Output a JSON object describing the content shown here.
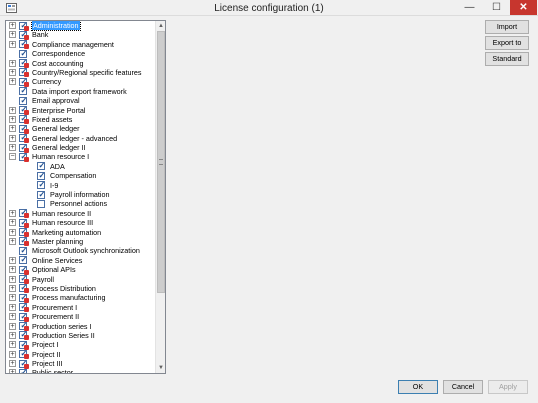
{
  "window": {
    "title": "License configuration (1)",
    "close_label": "✕",
    "min_label": "—",
    "max_label": "☐"
  },
  "tree": {
    "rows": [
      {
        "label": "Administration",
        "level": 0,
        "expander": "+",
        "mark": true,
        "selected": true
      },
      {
        "label": "Bank",
        "level": 0,
        "expander": "+",
        "mark": true
      },
      {
        "label": "Compliance management",
        "level": 0,
        "expander": "+",
        "mark": true
      },
      {
        "label": "Correspondence",
        "level": 0,
        "expander": "",
        "mark": false
      },
      {
        "label": "Cost accounting",
        "level": 0,
        "expander": "+",
        "mark": true
      },
      {
        "label": "Country/Regional specific features",
        "level": 0,
        "expander": "+",
        "mark": true
      },
      {
        "label": "Currency",
        "level": 0,
        "expander": "+",
        "mark": true
      },
      {
        "label": "Data import export framework",
        "level": 0,
        "expander": "",
        "mark": false
      },
      {
        "label": "Email approval",
        "level": 0,
        "expander": "",
        "mark": false
      },
      {
        "label": "Enterprise Portal",
        "level": 0,
        "expander": "+",
        "mark": true
      },
      {
        "label": "Fixed assets",
        "level": 0,
        "expander": "+",
        "mark": true
      },
      {
        "label": "General ledger",
        "level": 0,
        "expander": "+",
        "mark": true
      },
      {
        "label": "General ledger - advanced",
        "level": 0,
        "expander": "+",
        "mark": true
      },
      {
        "label": "General ledger II",
        "level": 0,
        "expander": "+",
        "mark": true
      },
      {
        "label": "Human resource I",
        "level": 0,
        "expander": "−",
        "mark": true
      },
      {
        "label": "ADA",
        "level": 1,
        "expander": "",
        "mark": false
      },
      {
        "label": "Compensation",
        "level": 1,
        "expander": "",
        "mark": false
      },
      {
        "label": "I-9",
        "level": 1,
        "expander": "",
        "mark": false
      },
      {
        "label": "Payroll information",
        "level": 1,
        "expander": "",
        "mark": false
      },
      {
        "label": "Personnel actions",
        "level": 1,
        "expander": "",
        "mark": false,
        "unchecked": true
      },
      {
        "label": "Human resource II",
        "level": 0,
        "expander": "+",
        "mark": true
      },
      {
        "label": "Human resource III",
        "level": 0,
        "expander": "+",
        "mark": true
      },
      {
        "label": "Marketing automation",
        "level": 0,
        "expander": "+",
        "mark": true
      },
      {
        "label": "Master planning",
        "level": 0,
        "expander": "+",
        "mark": true
      },
      {
        "label": "Microsoft Outlook synchronization",
        "level": 0,
        "expander": "",
        "mark": false
      },
      {
        "label": "Online Services",
        "level": 0,
        "expander": "+",
        "mark": false
      },
      {
        "label": "Optional APIs",
        "level": 0,
        "expander": "+",
        "mark": true
      },
      {
        "label": "Payroll",
        "level": 0,
        "expander": "+",
        "mark": true
      },
      {
        "label": "Process Distribution",
        "level": 0,
        "expander": "+",
        "mark": true
      },
      {
        "label": "Process manufacturing",
        "level": 0,
        "expander": "+",
        "mark": true
      },
      {
        "label": "Procurement I",
        "level": 0,
        "expander": "+",
        "mark": true
      },
      {
        "label": "Procurement II",
        "level": 0,
        "expander": "+",
        "mark": true
      },
      {
        "label": "Production series I",
        "level": 0,
        "expander": "+",
        "mark": true
      },
      {
        "label": "Production Series II",
        "level": 0,
        "expander": "+",
        "mark": true
      },
      {
        "label": "Project I",
        "level": 0,
        "expander": "+",
        "mark": true
      },
      {
        "label": "Project II",
        "level": 0,
        "expander": "+",
        "mark": true
      },
      {
        "label": "Project III",
        "level": 0,
        "expander": "+",
        "mark": true
      },
      {
        "label": "Public sector",
        "level": 0,
        "expander": "+",
        "mark": true
      }
    ]
  },
  "side_buttons": {
    "import": "Import",
    "export": "Export to",
    "standard": "Standard"
  },
  "footer_buttons": {
    "ok": "OK",
    "cancel": "Cancel",
    "apply": "Apply"
  },
  "colors": {
    "selection": "#3399ff",
    "close": "#c7362e",
    "mark": "#d9302e"
  }
}
